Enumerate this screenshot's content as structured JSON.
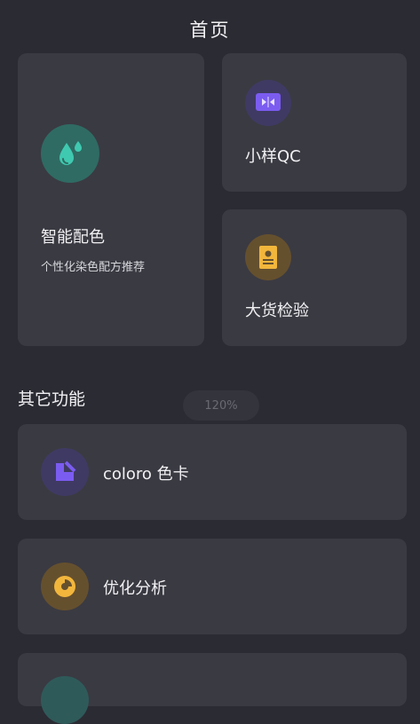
{
  "header": {
    "title": "首页"
  },
  "cards": {
    "color_matching": {
      "label": "智能配色",
      "subtitle": "个性化染色配方推荐",
      "icon": "water-drops-icon",
      "accent": "#3fc9b0"
    },
    "sample_qc": {
      "label": "小样QC",
      "icon": "compare-icon",
      "accent": "#7b5cf0"
    },
    "bulk_inspection": {
      "label": "大货检验",
      "icon": "document-icon",
      "accent": "#f2b63c"
    }
  },
  "section": {
    "title": "其它功能"
  },
  "zoom": {
    "label": "120%"
  },
  "list": [
    {
      "label": "coloro 色卡",
      "icon": "color-card-icon",
      "accent": "#7b5cf0"
    },
    {
      "label": "优化分析",
      "icon": "pie-chart-icon",
      "accent": "#f2b63c"
    },
    {
      "label": "",
      "icon": "partial-icon",
      "accent": "#3fb0a0"
    }
  ]
}
